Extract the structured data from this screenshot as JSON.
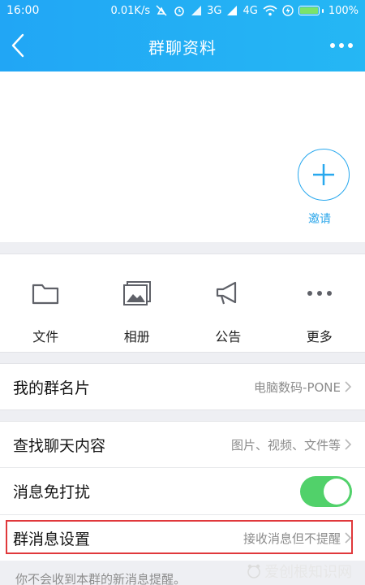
{
  "status_bar": {
    "time": "16:00",
    "net_speed": "0.01K/s",
    "network_3g": "3G",
    "network_4g": "4G",
    "battery": "100%",
    "battery_level": 1.0
  },
  "header": {
    "title": "群聊资料"
  },
  "members": {
    "invite_label": "邀请"
  },
  "actions": [
    {
      "label": "文件",
      "icon": "folder-icon"
    },
    {
      "label": "相册",
      "icon": "album-icon"
    },
    {
      "label": "公告",
      "icon": "megaphone-icon"
    },
    {
      "label": "更多",
      "icon": "more-dots-icon"
    }
  ],
  "settings": {
    "group_card": {
      "label": "我的群名片",
      "value": "电脑数码-PONE"
    },
    "search_chat": {
      "label": "查找聊天内容",
      "value": "图片、视频、文件等"
    },
    "do_not_disturb": {
      "label": "消息免打扰",
      "enabled": true
    },
    "msg_settings": {
      "label": "群消息设置",
      "value": "接收消息但不提醒"
    }
  },
  "hint_text": "你不会收到本群的新消息提醒。",
  "watermark": "爱创根知识网",
  "colors": {
    "header_blue": "#25b1f4",
    "accent": "#2aa6ea",
    "toggle_on": "#51d16a",
    "highlight_red": "#e0383b"
  }
}
